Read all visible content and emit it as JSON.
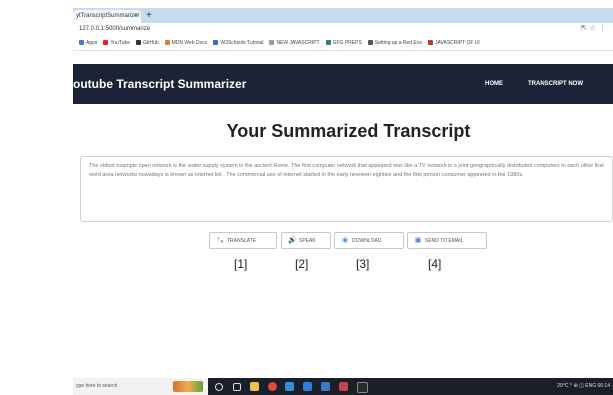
{
  "browser": {
    "tab_title": "ytTranscriptSummarizer",
    "tab_close": "×",
    "new_tab": "+",
    "url": "127.0.0.1:5000/summarize",
    "bookmarks": [
      {
        "label": "Apps",
        "color": "#4a7bd0"
      },
      {
        "label": "YouTube",
        "color": "#e62117"
      },
      {
        "label": "GitHub",
        "color": "#333333"
      },
      {
        "label": "MDN Web Docs",
        "color": "#d9822b"
      },
      {
        "label": "W3Schools Tutorial",
        "color": "#3b6bd6"
      },
      {
        "label": "NEW JAVASCRIPT",
        "color": "#9a9a9a"
      },
      {
        "label": "GFG PREPS",
        "color": "#2e8b57"
      },
      {
        "label": "Setting up a Red Env",
        "color": "#555555"
      },
      {
        "label": "JAVASCRIPT OF UI",
        "color": "#c0392b"
      }
    ]
  },
  "navbar": {
    "brand": "outube Transcript Summarizer",
    "home": "HOME",
    "transcript_now": "TRANSCRIPT NOW"
  },
  "main": {
    "heading": "Your Summarized Transcript",
    "summary": "The oldest example open network is the water supply system in the ancient Rome. The first computer network that appeared was like a TV network in a joint geographically distributed computers to each other that word area networks nowadays is known as internet list . The commercial use of internet started in the early nineteen eighties and the first person consumer appeared in the 1980s."
  },
  "actions": [
    {
      "label": "TRANSLATE",
      "icon": "translate-icon",
      "glyph": "⁺ₐ",
      "marker": "[1]"
    },
    {
      "label": "SPEAK",
      "icon": "speaker-icon",
      "glyph": "🔊",
      "marker": "[2]"
    },
    {
      "label": "DOWNLOAD",
      "icon": "download-icon",
      "glyph": "◉",
      "marker": "[3]"
    },
    {
      "label": "SEND TO EMAIL",
      "icon": "email-icon",
      "glyph": "▣",
      "marker": "[4]"
    }
  ],
  "taskbar": {
    "search_placeholder": "ype here to search",
    "tray": "29°C  ^  ⊕  ◫  ENG  06:14"
  }
}
